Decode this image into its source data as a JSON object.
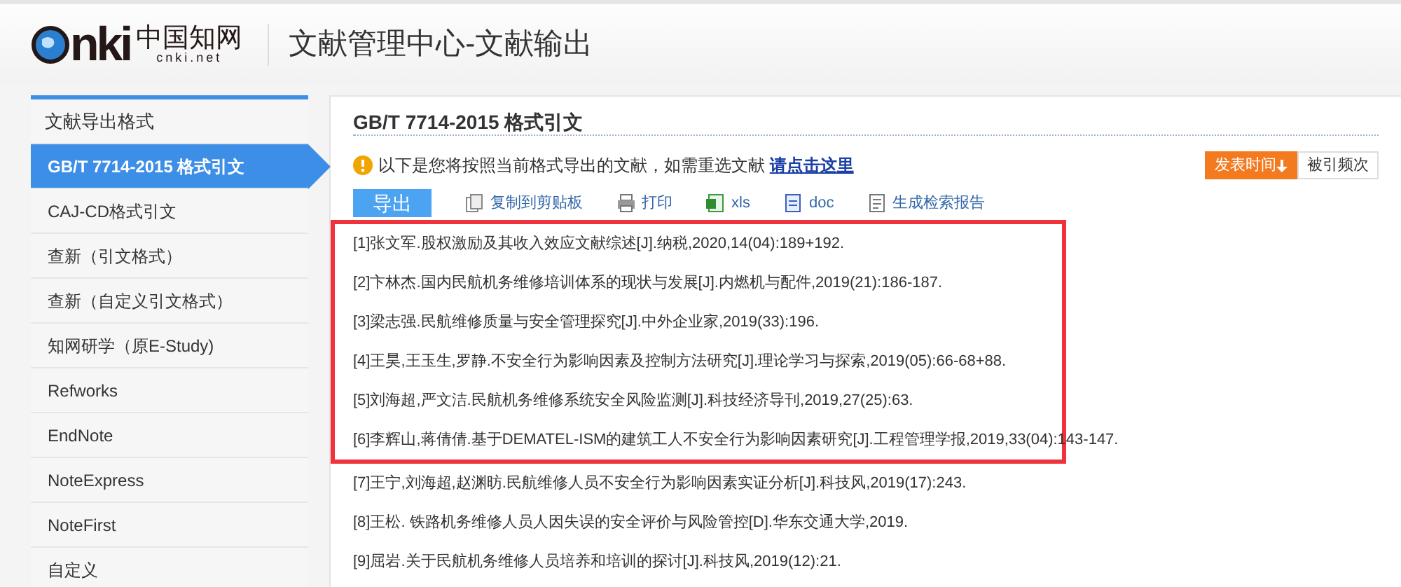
{
  "header": {
    "logo": {
      "mark": "nki",
      "name": "中国知网",
      "domain": "cnki.net"
    },
    "title": "文献管理中心-文献输出"
  },
  "sidebar": {
    "heading": "文献导出格式",
    "items": [
      {
        "label": "GB/T 7714-2015 格式引文",
        "selected": true
      },
      {
        "label": "CAJ-CD格式引文",
        "selected": false
      },
      {
        "label": "查新（引文格式）",
        "selected": false
      },
      {
        "label": "查新（自定义引文格式）",
        "selected": false
      },
      {
        "label": "知网研学（原E-Study)",
        "selected": false
      },
      {
        "label": "Refworks",
        "selected": false
      },
      {
        "label": "EndNote",
        "selected": false
      },
      {
        "label": "NoteExpress",
        "selected": false
      },
      {
        "label": "NoteFirst",
        "selected": false
      },
      {
        "label": "自定义",
        "selected": false
      }
    ]
  },
  "panel": {
    "title": "GB/T 7714-2015 格式引文",
    "notice": {
      "text": "以下是您将按照当前格式导出的文献，如需重选文献",
      "link": "请点击这里"
    },
    "sort": [
      {
        "label": "发表时间",
        "selected": true
      },
      {
        "label": "被引频次",
        "selected": false
      }
    ],
    "export_button": "导出",
    "tools": [
      {
        "kind": "copy",
        "label": "复制到剪贴板"
      },
      {
        "kind": "print",
        "label": "打印"
      },
      {
        "kind": "xls",
        "label": "xls"
      },
      {
        "kind": "doc",
        "label": "doc"
      },
      {
        "kind": "report",
        "label": "生成检索报告"
      }
    ],
    "references": [
      {
        "text": "[1]张文军.股权激励及其收入效应文献综述[J].纳税,2020,14(04):189+192.",
        "highlighted": true
      },
      {
        "text": "[2]卞林杰.国内民航机务维修培训体系的现状与发展[J].内燃机与配件,2019(21):186-187.",
        "highlighted": true
      },
      {
        "text": "[3]梁志强.民航维修质量与安全管理探究[J].中外企业家,2019(33):196.",
        "highlighted": true
      },
      {
        "text": "[4]王昊,王玉生,罗静.不安全行为影响因素及控制方法研究[J].理论学习与探索,2019(05):66-68+88.",
        "highlighted": true
      },
      {
        "text": "[5]刘海超,严文洁.民航机务维修系统安全风险监测[J].科技经济导刊,2019,27(25):63.",
        "highlighted": true
      },
      {
        "text": "[6]李辉山,蒋倩倩.基于DEMATEL-ISM的建筑工人不安全行为影响因素研究[J].工程管理学报,2019,33(04):143-147.",
        "highlighted": true
      },
      {
        "text": "[7]王宁,刘海超,赵渊昉.民航维修人员不安全行为影响因素实证分析[J].科技风,2019(17):243.",
        "highlighted": false
      },
      {
        "text": "[8]王松. 铁路机务维修人员人因失误的安全评价与风险管控[D].华东交通大学,2019.",
        "highlighted": false
      },
      {
        "text": "[9]屈岩.关于民航机务维修人员培养和培训的探讨[J].科技风,2019(12):21.",
        "highlighted": false
      }
    ]
  }
}
